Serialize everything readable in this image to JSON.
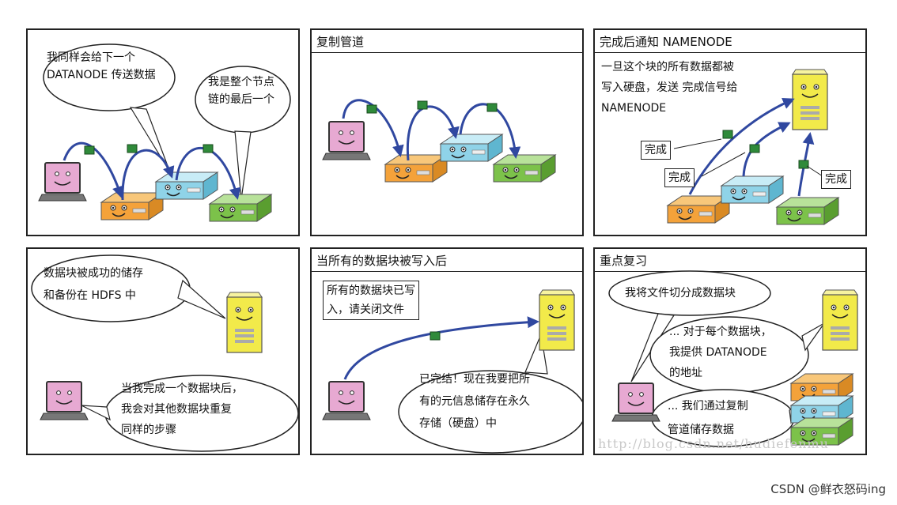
{
  "panels": {
    "p1": {
      "bubble_a": [
        "我同样会给下一个",
        "DATANODE 传送数据"
      ],
      "bubble_b": [
        "我是整个节点",
        "链的最后一个"
      ]
    },
    "p2": {
      "title": "复制管道"
    },
    "p3": {
      "title": "完成后通知 NAMENODE",
      "text": [
        "一旦这个块的所有数据都被",
        "写入硬盘，发送 完成信号给",
        "NAMENODE"
      ],
      "labels": [
        "完成",
        "完成",
        "完成"
      ]
    },
    "p4": {
      "bubble_a": [
        "数据块被成功的储存",
        "和备份在 HDFS 中"
      ],
      "bubble_b": [
        "当我完成一个数据块后，",
        "我会对其他数据块重复",
        "同样的步骤"
      ]
    },
    "p5": {
      "title": "当所有的数据块被写入后",
      "box": [
        "所有的数据块已写",
        "入，请关闭文件"
      ],
      "bubble": [
        "已完结！现在我要把所",
        "有的元信息储存在永久",
        "存储（硬盘）中"
      ]
    },
    "p6": {
      "title": "重点复习",
      "bubble_a": "我将文件切分成数据块",
      "bubble_b": [
        "... 对于每个数据块，",
        "我提供 DATANODE",
        "的地址"
      ],
      "bubble_c": [
        "... 我们通过复制",
        "管道储存数据"
      ]
    }
  },
  "watermark": "http://blog.csdn.net/hudiefenmu",
  "footer": "CSDN @鲜衣怒码ing",
  "colors": {
    "orange_server": "#f4a23a",
    "blue_server": "#8fd3e8",
    "green_server": "#7cc24a",
    "yellow_namenode": "#f2ea4a",
    "laptop_screen": "#e7a9d2",
    "arrow": "#3048a0",
    "packet": "#2f8a3a"
  }
}
